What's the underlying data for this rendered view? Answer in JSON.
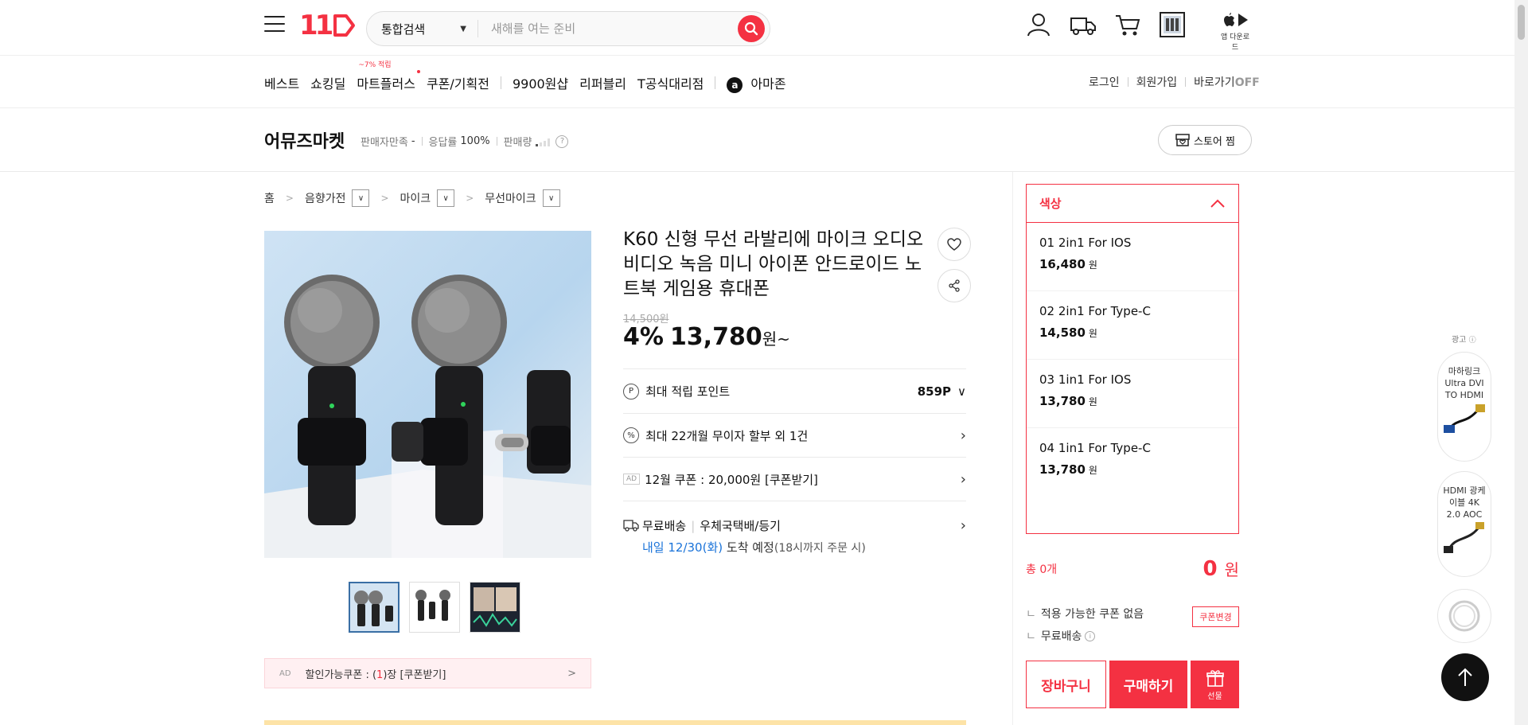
{
  "header": {
    "search_category": "통합검색",
    "search_placeholder": "새해를 여는 준비",
    "app_download": "앱 다운로드"
  },
  "gnb": {
    "items": [
      "베스트",
      "쇼킹딜",
      "마트플러스",
      "쿠폰/기획전",
      "9900원샵",
      "리퍼블리",
      "T공식대리점",
      "아마존"
    ],
    "mart_badge": "~7% 적립",
    "util": {
      "login": "로그인",
      "join": "회원가입",
      "shortcut": "바로가기",
      "shortcut_state": "OFF"
    }
  },
  "shop": {
    "name": "어뮤즈마켓",
    "satisfaction_label": "판매자만족",
    "satisfaction_value": "-",
    "response_label": "응답률",
    "response_value": "100%",
    "sales_label": "판매량",
    "store_button": "스토어 찜"
  },
  "breadcrumb": [
    "홈",
    "음향가전",
    "마이크",
    "무선마이크"
  ],
  "product": {
    "title": "K60 신형 무선 라발리에 마이크 오디오 비디오 녹음 미니 아이폰 안드로이드 노트북 게임용 휴대폰",
    "original_price": "14,500원",
    "discount_rate": "4%",
    "price": "13,780",
    "price_unit": "원~",
    "points_label": "최대 적립 포인트",
    "points_value": "859P",
    "installment": "최대 22개월 무이자 할부 외 1건",
    "coupon_ad": "AD",
    "coupon_text": "12월 쿠폰 : 20,000원 [쿠폰받기]",
    "shipping_free": "무료배송",
    "shipping_method": "우체국택배/등기",
    "arrival_date": "내일 12/30(화)",
    "arrival_text": "도착 예정",
    "arrival_note": "(18시까지 주문 시)",
    "discount_coupon_ad": "AD",
    "discount_coupon_prefix": "할인가능쿠폰 : (",
    "discount_coupon_count": "1",
    "discount_coupon_suffix": ")장 [쿠폰받기]"
  },
  "options": {
    "header": "색상",
    "items": [
      {
        "name": "01 2in1 For IOS",
        "price": "16,480",
        "unit": "원"
      },
      {
        "name": "02 2in1 For Type-C",
        "price": "14,580",
        "unit": "원"
      },
      {
        "name": "03 1in1 For IOS",
        "price": "13,780",
        "unit": "원"
      },
      {
        "name": "04 1in1 For Type-C",
        "price": "13,780",
        "unit": "원"
      }
    ],
    "total_count": "총 0개",
    "total_price": "0",
    "total_unit": "원",
    "no_coupon": "적용 가능한 쿠폰 없음",
    "coupon_change": "쿠폰변경",
    "free_shipping": "무료배송",
    "cart_button": "장바구니",
    "buy_button": "구매하기",
    "gift_button": "선물"
  },
  "ads": {
    "label": "광고",
    "cards": [
      "마하링크 Ultra DVI TO HDMI",
      "HDMI 광케이블 4K 2.0 AOC"
    ]
  },
  "colors": {
    "accent": "#f43142",
    "blue": "#1a73d9"
  }
}
